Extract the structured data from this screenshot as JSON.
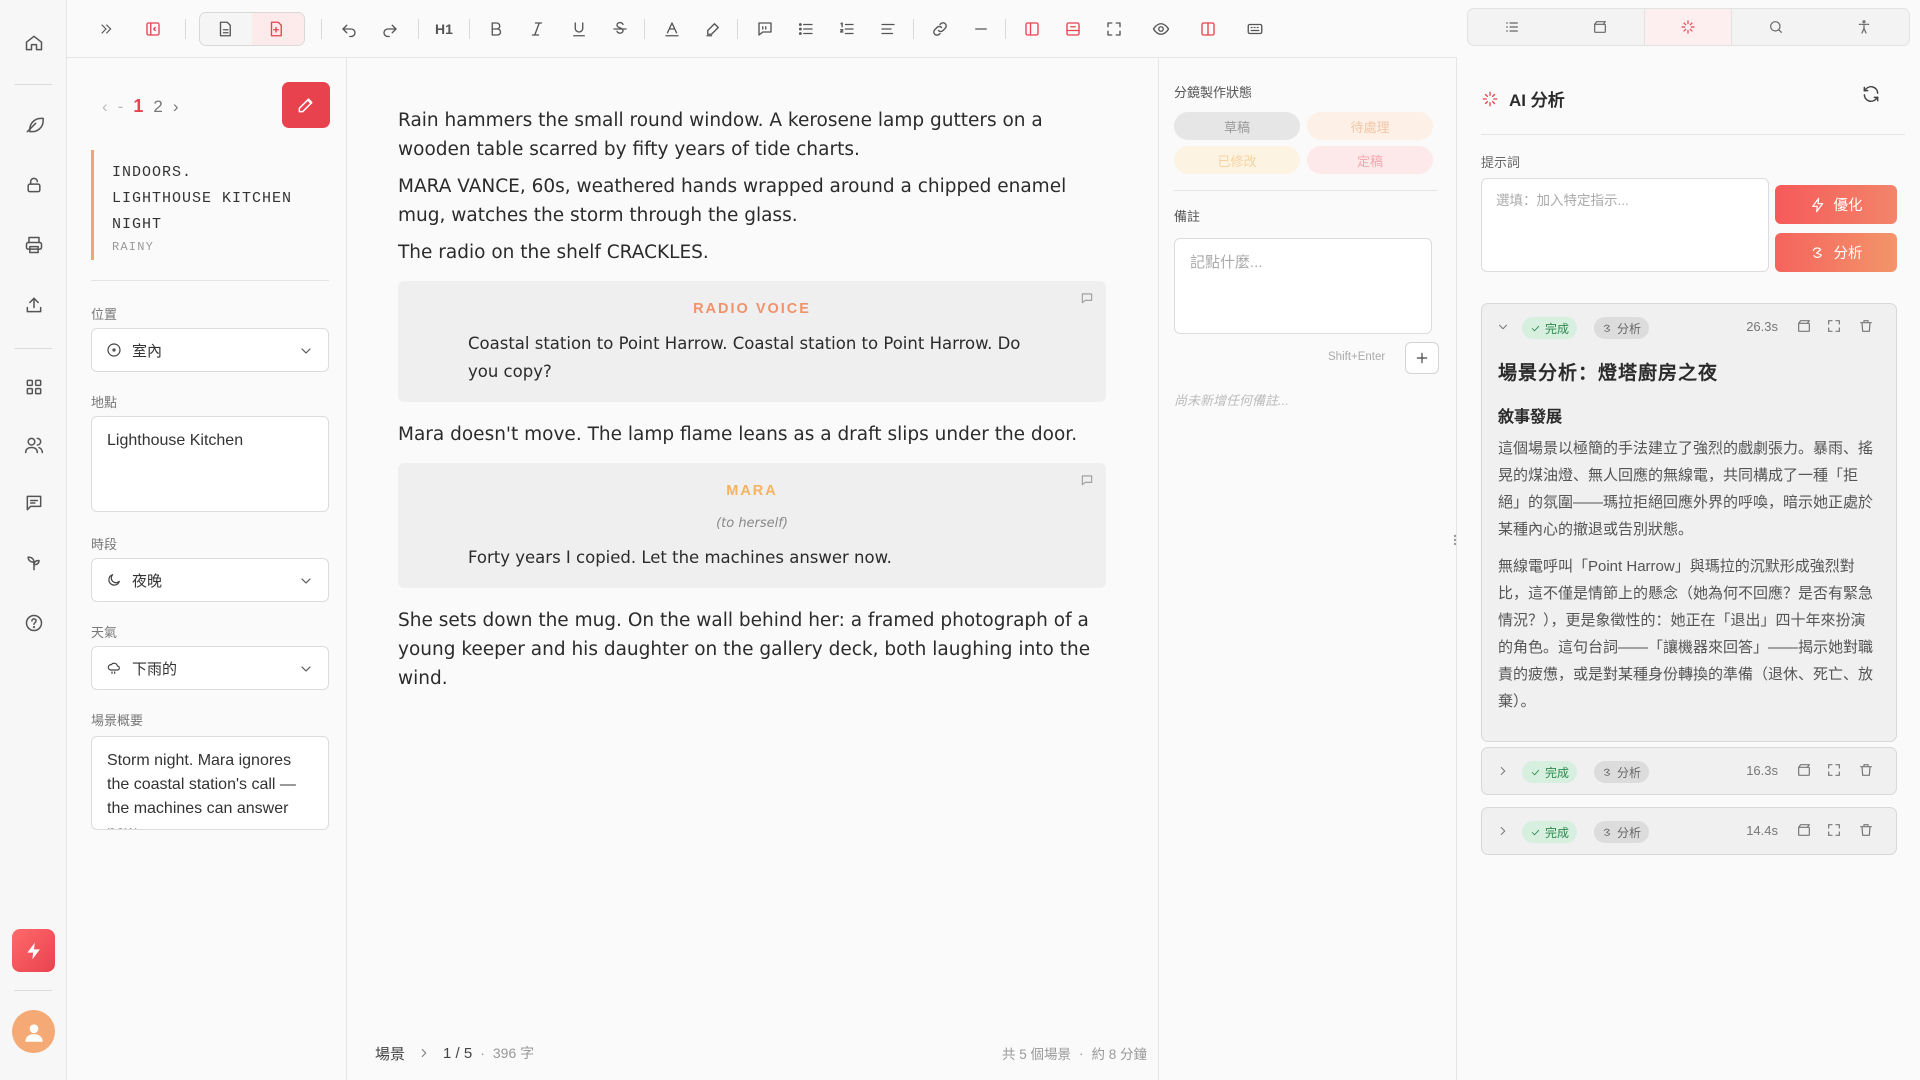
{
  "rail": {
    "items": [
      "home-icon",
      "feather-icon",
      "lock-icon",
      "printer-icon",
      "upload-icon",
      "grid-icon",
      "users-icon",
      "message-icon",
      "sprout-icon",
      "help-icon"
    ]
  },
  "toolbar": {
    "h1_label": "H1"
  },
  "scene_panel": {
    "pager": {
      "page1": "1",
      "page2": "2"
    },
    "heading": {
      "line1": "INDOORS.",
      "line2": "LIGHTHOUSE KITCHEN",
      "line3": "NIGHT",
      "weather": "RAINY"
    },
    "position_label": "位置",
    "position_value": "室內",
    "location_label": "地點",
    "location_value": "Lighthouse Kitchen",
    "time_label": "時段",
    "time_value": "夜晚",
    "weather_label": "天氣",
    "weather_value": "下雨的",
    "summary_label": "場景概要",
    "summary_value": "Storm night. Mara ignores the coastal station's call — the machines can answer now."
  },
  "editor": {
    "p1": "Rain hammers the small round window. A kerosene lamp gutters on a wooden table scarred by fifty years of tide charts.",
    "p2": "MARA VANCE, 60s, weathered hands wrapped around a chipped enamel mug, watches the storm through the glass.",
    "p3": "The radio on the shelf CRACKLES.",
    "dialogue1": {
      "character": "RADIO VOICE",
      "line": "Coastal station to Point Harrow. Coastal station to Point Harrow. Do you copy?",
      "color": "#f0926a"
    },
    "p4": "Mara doesn't move. The lamp flame leans as a draft slips under the door.",
    "dialogue2": {
      "character": "MARA",
      "parenthetical": "(to herself)",
      "line": "Forty years I copied. Let the machines answer now.",
      "color": "#f5b261"
    },
    "p5": "She sets down the mug. On the wall behind her: a framed photograph of a young keeper and his daughter on the gallery deck, both laughing into the wind.",
    "footer": {
      "section": "場景",
      "position": "1 / 5",
      "word_count": "396 字",
      "total_scenes": "共 5 個場景",
      "duration": "約 8 分鐘"
    }
  },
  "status_panel": {
    "title": "分鏡製作狀態",
    "chips": [
      {
        "label": "草稿",
        "bg": "#e6e6e6",
        "fg": "#9a9a9a"
      },
      {
        "label": "待處理",
        "bg": "#fdf0e6",
        "fg": "#f3c6a6"
      },
      {
        "label": "已修改",
        "bg": "#fdf3e3",
        "fg": "#f5d3a0"
      },
      {
        "label": "定稿",
        "bg": "#fde8ea",
        "fg": "#f4a7ae"
      }
    ],
    "notes_label": "備註",
    "notes_placeholder": "記點什麼...",
    "shortcut_hint": "Shift+Enter",
    "empty_text": "尚未新增任何備註..."
  },
  "ai_panel": {
    "title": "AI 分析",
    "prompt_label": "提示詞",
    "prompt_placeholder": "選填：加入特定指示...",
    "optimize_label": "優化",
    "analyze_label": "分析",
    "results": [
      {
        "status": "完成",
        "kind": "分析",
        "time": "26.3s",
        "title": "場景分析：燈塔廚房之夜",
        "subtitle": "敘事發展",
        "para1": "這個場景以極簡的手法建立了強烈的戲劇張力。暴雨、搖晃的煤油燈、無人回應的無線電，共同構成了一種「拒絕」的氛圍——瑪拉拒絕回應外界的呼喚，暗示她正處於某種內心的撤退或告別狀態。",
        "para2": "無線電呼叫「Point Harrow」與瑪拉的沉默形成強烈對比，這不僅是情節上的懸念（她為何不回應？是否有緊急情況？），更是象徵性的：她正在「退出」四十年來扮演的角色。這句台詞——「讓機器來回答」——揭示她對職責的疲憊，或是對某種身份轉換的準備（退休、死亡、放棄）。"
      },
      {
        "status": "完成",
        "kind": "分析",
        "time": "16.3s"
      },
      {
        "status": "完成",
        "kind": "分析",
        "time": "14.4s"
      }
    ],
    "accent": "#e8424f"
  }
}
